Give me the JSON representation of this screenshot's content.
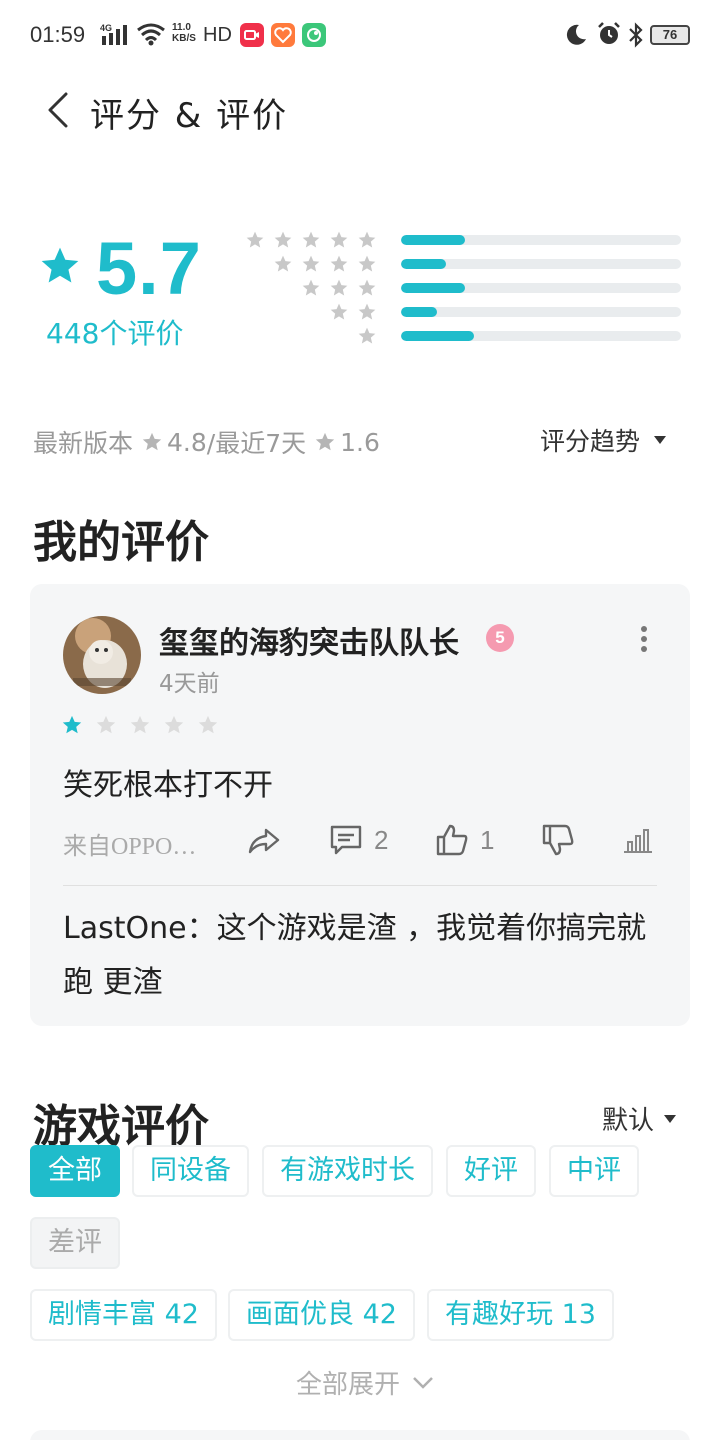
{
  "status_bar": {
    "time": "01:59",
    "signal": "4G",
    "net_speed_value": "11.0",
    "net_speed_unit": "KB/S",
    "hd": "HD",
    "battery": "76"
  },
  "header": {
    "title": "评分 & 评价"
  },
  "rating": {
    "score": "5.7",
    "count_label": "448个评价",
    "distribution": [
      {
        "stars": 5,
        "fraction": 0.23
      },
      {
        "stars": 4,
        "fraction": 0.16
      },
      {
        "stars": 3,
        "fraction": 0.23
      },
      {
        "stars": 2,
        "fraction": 0.13
      },
      {
        "stars": 1,
        "fraction": 0.26
      }
    ]
  },
  "version_info": {
    "latest_label": "最新版本",
    "latest_score": "4.8",
    "recent_label": "/最近7天",
    "recent_score": "1.6",
    "trend_label": "评分趋势"
  },
  "my_review": {
    "section_title": "我的评价",
    "username": "玺玺的海豹突击队队长",
    "badge": "5",
    "time": "4天前",
    "stars": 1,
    "text": "笑死根本打不开",
    "source": "来自OPPO…",
    "comment_count": "2",
    "like_count": "1",
    "reply": "LastOne：这个游戏是渣 ，我觉着你搞完就跑 更渣"
  },
  "game_reviews": {
    "section_title": "游戏评价",
    "sort_label": "默认",
    "filters": [
      "全部",
      "同设备",
      "有游戏时长",
      "好评",
      "中评",
      "差评"
    ],
    "tags": [
      "剧情丰富 42",
      "画面优良 42",
      "有趣好玩 13"
    ],
    "expand_label": "全部展开"
  },
  "colors": {
    "accent": "#1fbccb",
    "star_grey": "#c8c8c8",
    "card_bg": "#f5f6f7"
  }
}
